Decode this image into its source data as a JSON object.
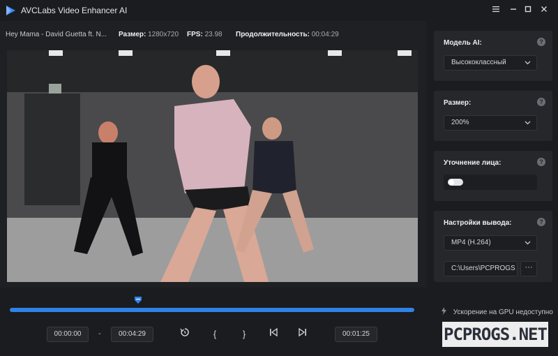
{
  "titlebar": {
    "title": "AVCLabs Video Enhancer AI",
    "icons": [
      "play-logo-icon",
      "menu-icon",
      "minimize-icon",
      "maximize-icon",
      "close-icon"
    ]
  },
  "info": {
    "filename": "Hey Mama - David Guetta ft. N...",
    "size_label": "Размер:",
    "size_value": "1280x720",
    "fps_label": "FPS:",
    "fps_value": "23.98",
    "duration_label": "Продолжительность:",
    "duration_value": "00:04:29"
  },
  "timeline": {
    "progress": 0.33,
    "accent_color": "#2f82e8",
    "start_time": "00:00:00",
    "separator": "-",
    "end_time": "00:04:29",
    "current_time": "00:01:25",
    "controls": [
      "refresh-icon",
      "bracket-open-icon",
      "bracket-close-icon",
      "skip-back-icon",
      "skip-forward-icon"
    ],
    "bracket_open": "{",
    "bracket_close": "}"
  },
  "panel": {
    "ai_model": {
      "label": "Модель AI:",
      "value": "Высококлассный",
      "help": "?"
    },
    "size": {
      "label": "Размер:",
      "value": "200%",
      "help": "?"
    },
    "face": {
      "label": "Уточнение лица:",
      "help": "?",
      "enabled": false
    },
    "output": {
      "label": "Настройки вывода:",
      "help": "?",
      "format": "MP4 (H.264)",
      "path": "C:\\Users\\PCPROGS",
      "more": "···"
    },
    "gpu_text": "Ускорение на GPU недоступно"
  },
  "watermark": "PCPROGS.NET"
}
